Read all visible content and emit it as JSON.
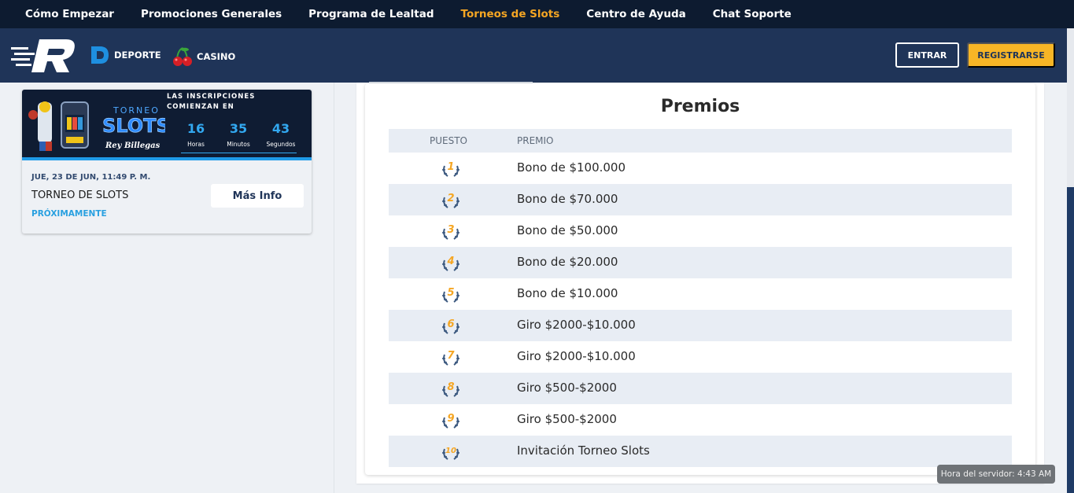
{
  "topnav": {
    "items": [
      {
        "label": "Cómo Empezar"
      },
      {
        "label": "Promociones Generales"
      },
      {
        "label": "Programa de Lealtad"
      },
      {
        "label": "Torneos de Slots"
      },
      {
        "label": "Centro de Ayuda"
      },
      {
        "label": "Chat Soporte"
      }
    ],
    "active_color": "#f5a623"
  },
  "header": {
    "logo_icon": "r-brand-logo-icon",
    "deporte_label": "DEPORTE",
    "casino_label": "CASINO",
    "login_label": "ENTRAR",
    "register_label": "REGISTRARSE",
    "accent_color": "#f7b526",
    "bg_color": "#1f3458"
  },
  "tournament_card": {
    "banner_line1": "TORNEO",
    "banner_line2": "SLOTS",
    "banner_line3": "Rey Billegas",
    "inscriptions_text": "LAS INSCRIPCIONES COMIENZAN EN",
    "countdown": [
      {
        "value": "16",
        "label": "Horas"
      },
      {
        "value": "35",
        "label": "Minutos"
      },
      {
        "value": "43",
        "label": "Segundos"
      }
    ],
    "date": "JUE, 23 DE JUN, 11:49 P. M.",
    "title": "TORNEO DE SLOTS",
    "status": "PRÓXIMAMENTE",
    "info_button": "Más Info"
  },
  "prizes": {
    "title": "Premios",
    "col_position": "PUESTO",
    "col_prize": "PREMIO",
    "rows": [
      {
        "position": "1",
        "prize": "Bono de $100.000"
      },
      {
        "position": "2",
        "prize": "Bono de $70.000"
      },
      {
        "position": "3",
        "prize": "Bono de $50.000"
      },
      {
        "position": "4",
        "prize": "Bono de $20.000"
      },
      {
        "position": "5",
        "prize": "Bono de $10.000"
      },
      {
        "position": "6",
        "prize": "Giro $2000-$10.000"
      },
      {
        "position": "7",
        "prize": "Giro $2000-$10.000"
      },
      {
        "position": "8",
        "prize": "Giro $500-$2000"
      },
      {
        "position": "9",
        "prize": "Giro $500-$2000"
      },
      {
        "position": "10",
        "prize": "Invitación Torneo Slots"
      }
    ]
  },
  "server_time": "Hora del servidor: 4:43 AM"
}
